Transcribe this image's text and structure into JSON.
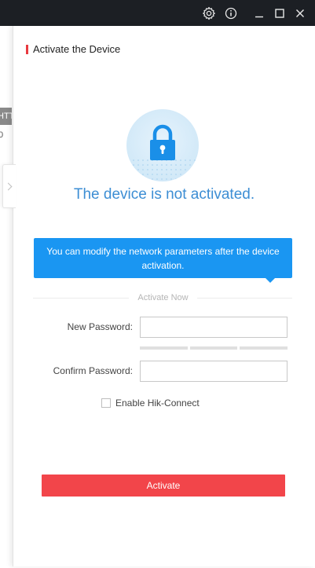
{
  "titlebar": {
    "icons": [
      "gear-icon",
      "info-icon",
      "minimize-icon",
      "maximize-icon",
      "close-icon"
    ]
  },
  "background_list": {
    "tag_text": "HTTP",
    "value_text": "0"
  },
  "panel": {
    "header_title": "Activate the Device",
    "lock_icon": "lock-icon",
    "status": "The device is not activated.",
    "tooltip": "You can modify the network parameters after the device activation.",
    "divider_label": "Activate Now",
    "form": {
      "new_password_label": "New Password:",
      "new_password_value": "",
      "confirm_password_label": "Confirm Password:",
      "confirm_password_value": "",
      "password_strength_segments": 3
    },
    "hik_connect": {
      "label": "Enable Hik-Connect",
      "checked": false
    },
    "activate_button": "Activate"
  },
  "colors": {
    "accent_red": "#f2454a",
    "status_blue": "#3d8ed4",
    "tooltip_blue": "#1a96f2",
    "titlebar": "#1c1f24"
  }
}
